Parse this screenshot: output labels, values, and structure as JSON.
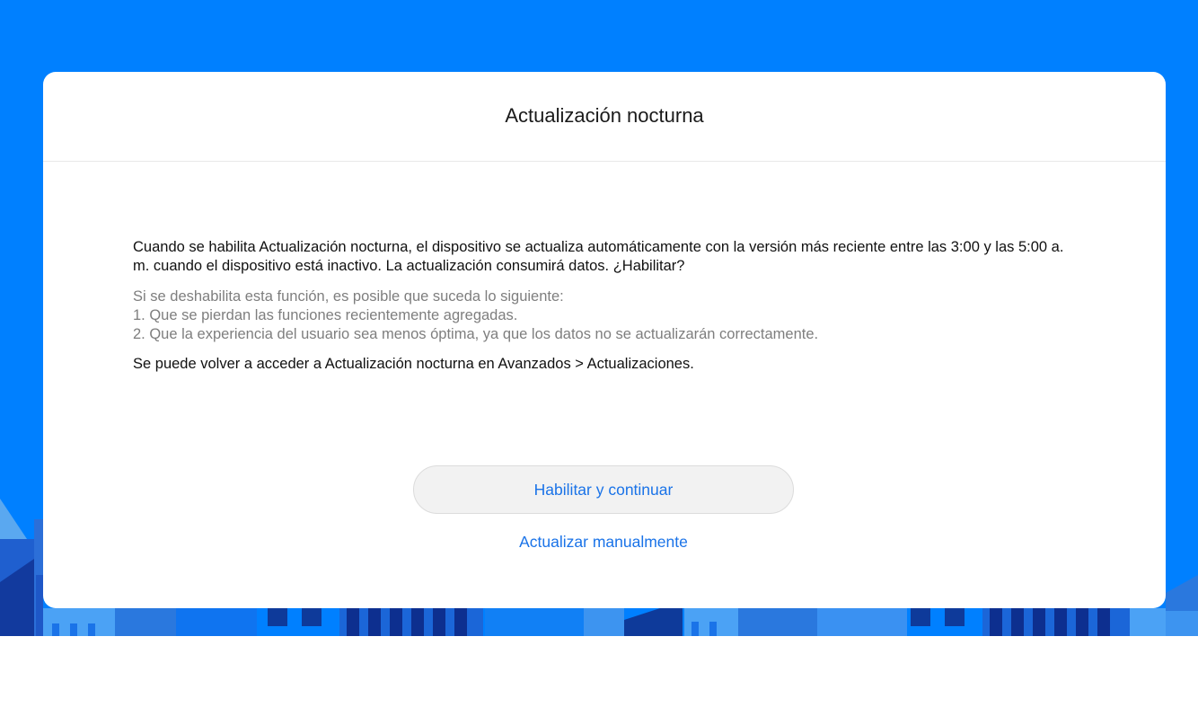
{
  "colors": {
    "background": "#0080ff",
    "accent": "#1a73e8",
    "muted_text": "#7e7e7e"
  },
  "dialog": {
    "title": "Actualización nocturna",
    "description": "Cuando se habilita Actualización nocturna, el dispositivo se actualiza automáticamente con la versión más reciente entre las 3:00 y las 5:00 a. m. cuando el dispositivo está inactivo. La actualización consumirá datos. ¿Habilitar?",
    "warning": {
      "intro": "Si se deshabilita esta función, es posible que suceda lo siguiente:",
      "items": [
        "1. Que se pierdan las funciones recientemente agregadas.",
        "2. Que la experiencia del usuario sea menos óptima, ya que los datos no se actualizarán correctamente."
      ]
    },
    "hint": "Se puede volver a acceder a Actualización nocturna en Avanzados > Actualizaciones.",
    "primary_button": "Habilitar y continuar",
    "secondary_link": "Actualizar manualmente"
  }
}
